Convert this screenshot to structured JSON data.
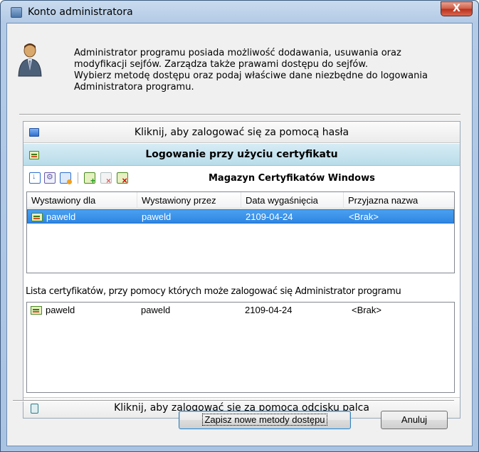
{
  "window": {
    "title": "Konto administratora",
    "close_label": "X"
  },
  "intro": {
    "lines": [
      "Administrator programu posiada możliwość dodawania, usuwania oraz",
      "modyfikacji sejfów. Zarządza także prawami dostępu do sejfów.",
      "Wybierz metodę dostępu oraz podaj właściwe dane niezbędne do logowania",
      "Administratora programu."
    ]
  },
  "password_bar": {
    "label": "Kliknij, aby zalogować się za pomocą hasła"
  },
  "cert_bar": {
    "label": "Logowanie przy użyciu certyfikatu"
  },
  "toolbar": {
    "store_title": "Magazyn Certyfikatów Windows",
    "icons": [
      "import-cert-icon",
      "cert-properties-icon",
      "refresh-store-icon",
      "add-cert-icon",
      "remove-cert-disabled-icon",
      "delete-cert-icon"
    ]
  },
  "store_list": {
    "columns": [
      "Wystawiony dla",
      "Wystawiony przez",
      "Data wygaśnięcia",
      "Przyjazna nazwa"
    ],
    "rows": [
      {
        "issued_to": "paweld",
        "issued_by": "paweld",
        "expires": "2109-04-24",
        "friendly_name": "<Brak>",
        "selected": true
      }
    ]
  },
  "admin_list": {
    "caption": "Lista certyfikatów, przy pomocy których może zalogować się Administrator programu",
    "rows": [
      {
        "issued_to": "paweld",
        "issued_by": "paweld",
        "expires": "2109-04-24",
        "friendly_name": "<Brak>"
      }
    ]
  },
  "fingerprint_bar": {
    "label": "Kliknij, aby zalogować się za pomocą odcisku palca"
  },
  "buttons": {
    "save": "Zapisz nowe metody dostępu",
    "cancel": "Anuluj"
  },
  "colors": {
    "selection": "#3393e8",
    "cert_bar": "#c6e4f0",
    "title_gradient": "#b4cbe6"
  }
}
